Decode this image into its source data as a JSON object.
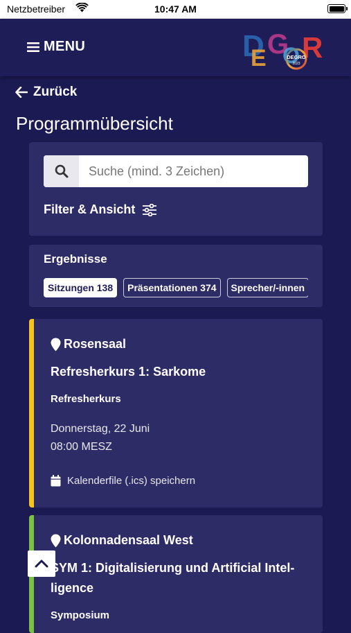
{
  "status_bar": {
    "carrier": "Netzbetreiber",
    "time": "10:47 AM"
  },
  "header": {
    "menu_label": "MENU",
    "logo": {
      "letters": "DEGRO",
      "badge": "DEGRO",
      "year": "2023"
    }
  },
  "nav": {
    "back_label": "Zurück"
  },
  "page": {
    "title": "Programmübersicht"
  },
  "search": {
    "placeholder": "Suche (mind. 3 Zeichen)",
    "value": ""
  },
  "filter": {
    "label": "Filter & Ansicht"
  },
  "results": {
    "label": "Ergebnisse",
    "chips": [
      {
        "label": "Sitzungen 138",
        "active": true
      },
      {
        "label": "Präsentationen 374",
        "active": false
      },
      {
        "label": "Sprecher/-innen",
        "active": false
      }
    ]
  },
  "sessions": [
    {
      "room": "Rosensaal",
      "title": "Refresherkurs 1: Sarkome",
      "type": "Refresherkurs",
      "date": "Donnerstag, 22 Juni",
      "time": "08:00 MESZ",
      "ics_label": "Kalenderfile (.ics) speichern",
      "accent_color": "#f5c518"
    },
    {
      "room": "Kolonnadensaal West",
      "title": "SYM 1: Digitalisierung und Artificial Intel-ligence",
      "type": "Symposium",
      "accent_color": "#7cc242"
    }
  ],
  "colors": {
    "background": "#1b1a52",
    "panel": "#2d2c66",
    "header": "#1e1d57"
  }
}
